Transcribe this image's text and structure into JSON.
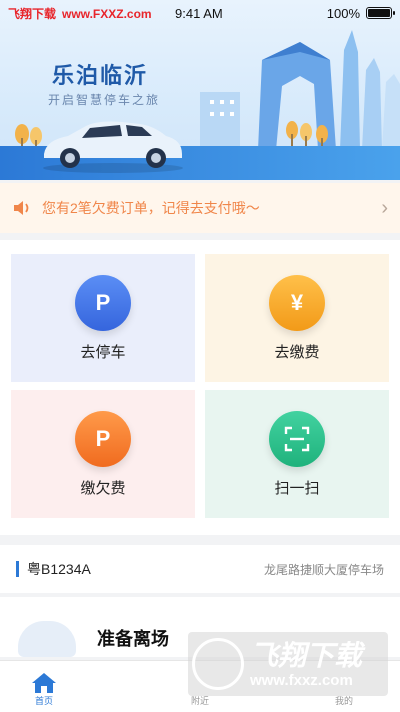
{
  "watermark_top": {
    "brand": "飞翔下载",
    "url": "www.FXXZ.com"
  },
  "status_bar": {
    "time": "9:41 AM",
    "battery": "100%"
  },
  "banner": {
    "title": "乐泊临沂",
    "subtitle": "开启智慧停车之旅"
  },
  "notice": {
    "text": "您有2笔欠费订单，记得去支付哦～"
  },
  "tiles": [
    {
      "label": "去停车",
      "icon": "parking-icon"
    },
    {
      "label": "去缴费",
      "icon": "yen-icon",
      "glyph": "¥"
    },
    {
      "label": "缴欠费",
      "icon": "arrears-icon"
    },
    {
      "label": "扫一扫",
      "icon": "scan-icon"
    }
  ],
  "vehicle": {
    "plate": "粤B1234A",
    "lot": "龙尾路捷顺大厦停车场",
    "status": "准备离场"
  },
  "watermark_bottom": {
    "brand": "飞翔下载",
    "url": "www.fxxz.com"
  },
  "tabs": [
    {
      "label": "首页",
      "active": true
    },
    {
      "label": "附近",
      "active": false
    },
    {
      "label": "我的",
      "active": false
    }
  ],
  "colors": {
    "primary": "#2c79d6",
    "notice": "#f0864a"
  }
}
